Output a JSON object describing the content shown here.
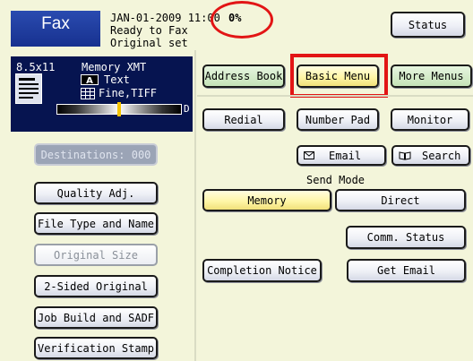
{
  "header": {
    "app_title": "Fax",
    "date_time": "JAN-01-2009  11:00",
    "percent": "0%",
    "status_line1": "Ready to Fax",
    "status_line2": "Original set",
    "status_button": "Status"
  },
  "settings": {
    "paper_size": "8.5x11",
    "memory_mode": "Memory XMT",
    "text_mode": "Text",
    "resolution": "Fine,TIFF",
    "contrast_end_label": "D",
    "contrast_level": 0.5
  },
  "left_panel": {
    "destinations": "Destinations: 000",
    "quality_adj": "Quality Adj.",
    "file_type": "File Type and Name",
    "original_size": "Original Size",
    "two_sided": "2-Sided Original",
    "job_build": "Job Build and SADF",
    "verification": "Verification Stamp"
  },
  "tabs": {
    "address_book": "Address Book",
    "basic_menu": "Basic Menu",
    "more_menus": "More Menus"
  },
  "actions": {
    "redial": "Redial",
    "number_pad": "Number Pad",
    "monitor": "Monitor",
    "email": "Email",
    "search": "Search"
  },
  "send_mode": {
    "label": "Send Mode",
    "memory": "Memory",
    "direct": "Direct"
  },
  "misc": {
    "comm_status": "Comm. Status",
    "completion_notice": "Completion Notice",
    "get_email": "Get Email"
  },
  "colors": {
    "header_blue": "#17318f",
    "panel_navy": "#061450",
    "background": "#f3f5da",
    "selected": "#fff6a8",
    "highlight_red": "#e21515"
  }
}
